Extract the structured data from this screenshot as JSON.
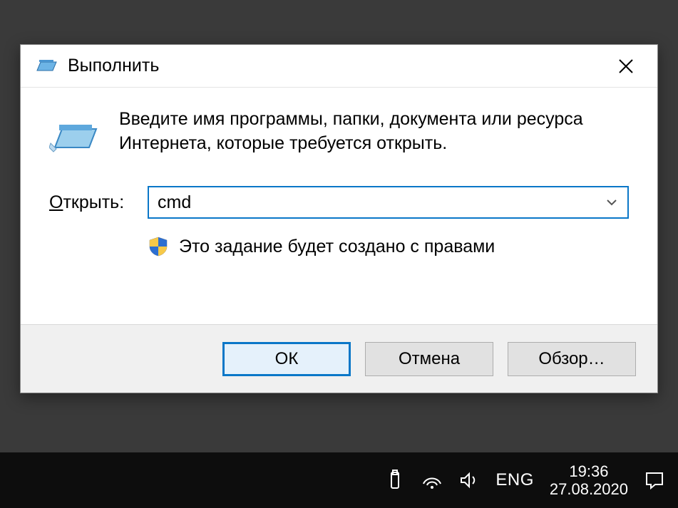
{
  "dialog": {
    "title": "Выполнить",
    "description": "Введите имя программы, папки, документа или ресурса Интернета, которые требуется открыть.",
    "open_label_prefix": "О",
    "open_label_rest": "ткрыть:",
    "input_value": "cmd",
    "shield_text": "Это задание будет создано с правами",
    "buttons": {
      "ok": "ОК",
      "cancel": "Отмена",
      "browse": "Обзор…"
    }
  },
  "taskbar": {
    "language": "ENG",
    "time": "19:36",
    "date": "27.08.2020"
  }
}
